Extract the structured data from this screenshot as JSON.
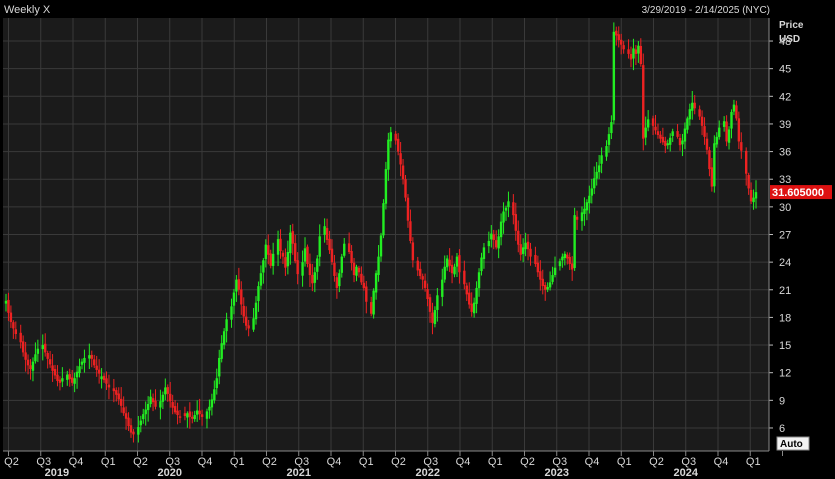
{
  "header": {
    "title": "Weekly X",
    "date_range": "3/29/2019 - 2/14/2025 (NYC)"
  },
  "axis": {
    "price_label_line1": "Price",
    "price_label_line2": "USD",
    "auto_label": "Auto"
  },
  "colors": {
    "background": "#000000",
    "plot_background": "#1b1b1b",
    "grid": "#3a3a3a",
    "up": "#22ee22",
    "down": "#ee2222",
    "last_price_badge": "#dd1111",
    "text": "#d8d8d8"
  },
  "chart_data": {
    "type": "candlestick",
    "title": "Weekly X",
    "subtitle": "3/29/2019 - 2/14/2025 (NYC)",
    "ylabel": "Price USD",
    "ylim": [
      3.5,
      50.5
    ],
    "y_ticks": [
      6,
      9,
      12,
      15,
      18,
      21,
      24,
      27,
      30,
      33,
      36,
      39,
      42,
      45,
      48
    ],
    "y_tick_labels": [
      "6",
      "9",
      "12",
      "15",
      "18",
      "21",
      "24",
      "27",
      "30",
      "33",
      "36",
      "39",
      "42",
      "45",
      "48"
    ],
    "last_price": 31.605,
    "last_price_label": "31.605000",
    "grid": true,
    "x_quarters": [
      "Q2",
      "Q3",
      "Q4",
      "Q1",
      "Q2",
      "Q3",
      "Q4",
      "Q1",
      "Q2",
      "Q3",
      "Q4",
      "Q1",
      "Q2",
      "Q3",
      "Q4",
      "Q1",
      "Q2",
      "Q3",
      "Q4",
      "Q1",
      "Q2",
      "Q3",
      "Q4",
      "Q1"
    ],
    "x_years": [
      "2019",
      "2020",
      "2021",
      "2022",
      "2023",
      "2024"
    ],
    "weekly_closes": [
      19.8,
      18.5,
      17.5,
      16.8,
      16.2,
      15.3,
      14.2,
      13.4,
      12.8,
      12.4,
      13.2,
      14.0,
      14.6,
      15.0,
      14.2,
      13.5,
      12.9,
      12.2,
      11.7,
      11.1,
      10.9,
      11.4,
      11.8,
      11.3,
      10.9,
      11.4,
      12.1,
      12.7,
      13.2,
      13.6,
      13.9,
      13.5,
      12.8,
      12.3,
      11.9,
      11.6,
      11.2,
      10.8,
      10.4,
      10.0,
      9.6,
      9.1,
      8.4,
      7.6,
      7.0,
      6.2,
      5.5,
      5.3,
      6.1,
      6.8,
      7.5,
      8.0,
      8.6,
      9.4,
      8.8,
      8.3,
      8.9,
      9.6,
      10.4,
      9.7,
      8.9,
      8.2,
      7.7,
      7.4,
      7.1,
      7.3,
      7.6,
      7.2,
      7.0,
      7.4,
      7.9,
      7.5,
      7.2,
      7.8,
      8.3,
      9.1,
      10.2,
      11.4,
      13.6,
      15.2,
      16.5,
      17.8,
      19.2,
      20.7,
      22.1,
      21.0,
      19.4,
      18.1,
      17.1,
      16.8,
      17.9,
      19.6,
      21.4,
      22.8,
      24.2,
      25.9,
      24.8,
      23.6,
      24.9,
      26.5,
      25.2,
      24.6,
      23.4,
      25.1,
      27.2,
      26.0,
      24.1,
      22.7,
      24.0,
      25.5,
      23.8,
      22.6,
      21.7,
      22.9,
      24.4,
      26.8,
      27.9,
      26.4,
      25.3,
      24.0,
      22.5,
      21.2,
      22.8,
      24.6,
      26.0,
      25.1,
      23.9,
      22.6,
      23.5,
      22.9,
      21.8,
      21.2,
      19.7,
      18.4,
      20.9,
      22.8,
      24.6,
      26.9,
      30.4,
      34.1,
      37.3,
      38.1,
      37.2,
      36.0,
      34.6,
      33.0,
      31.0,
      28.5,
      26.3,
      24.2,
      23.1,
      22.5,
      22.1,
      21.2,
      20.0,
      18.6,
      17.4,
      18.8,
      20.4,
      22.1,
      23.5,
      24.4,
      23.6,
      22.8,
      23.5,
      24.6,
      22.9,
      21.6,
      20.5,
      19.4,
      18.6,
      19.6,
      21.2,
      22.9,
      24.5,
      25.6,
      26.3,
      27.1,
      26.4,
      25.6,
      26.8,
      28.4,
      29.5,
      29.9,
      30.6,
      29.1,
      27.4,
      25.9,
      24.8,
      25.6,
      26.1,
      25.4,
      24.6,
      23.8,
      22.9,
      22.1,
      21.4,
      21.0,
      21.3,
      21.8,
      22.6,
      23.4,
      24.1,
      24.6,
      24.9,
      24.4,
      23.8,
      23.2,
      29.1,
      28.6,
      29.4,
      29.8,
      30.5,
      31.2,
      32.0,
      33.1,
      33.8,
      34.5,
      35.6,
      36.6,
      37.9,
      39.2,
      49.0,
      48.6,
      48.1,
      47.6,
      47.1,
      46.6,
      46.0,
      47.2,
      46.6,
      47.5,
      45.5,
      37.4,
      38.6,
      39.5,
      38.8,
      38.3,
      37.8,
      37.4,
      37.0,
      36.6,
      36.9,
      37.5,
      38.2,
      37.6,
      36.7,
      37.2,
      38.5,
      39.6,
      40.6,
      41.3,
      40.7,
      39.8,
      38.8,
      37.6,
      36.2,
      34.1,
      32.2,
      36.9,
      37.6,
      38.6,
      39.3,
      37.1,
      38.4,
      40.3,
      41.1,
      39.6,
      37.1,
      36.1,
      33.6,
      32.0,
      30.6,
      31.0,
      31.6
    ],
    "weeks_total": 307
  }
}
